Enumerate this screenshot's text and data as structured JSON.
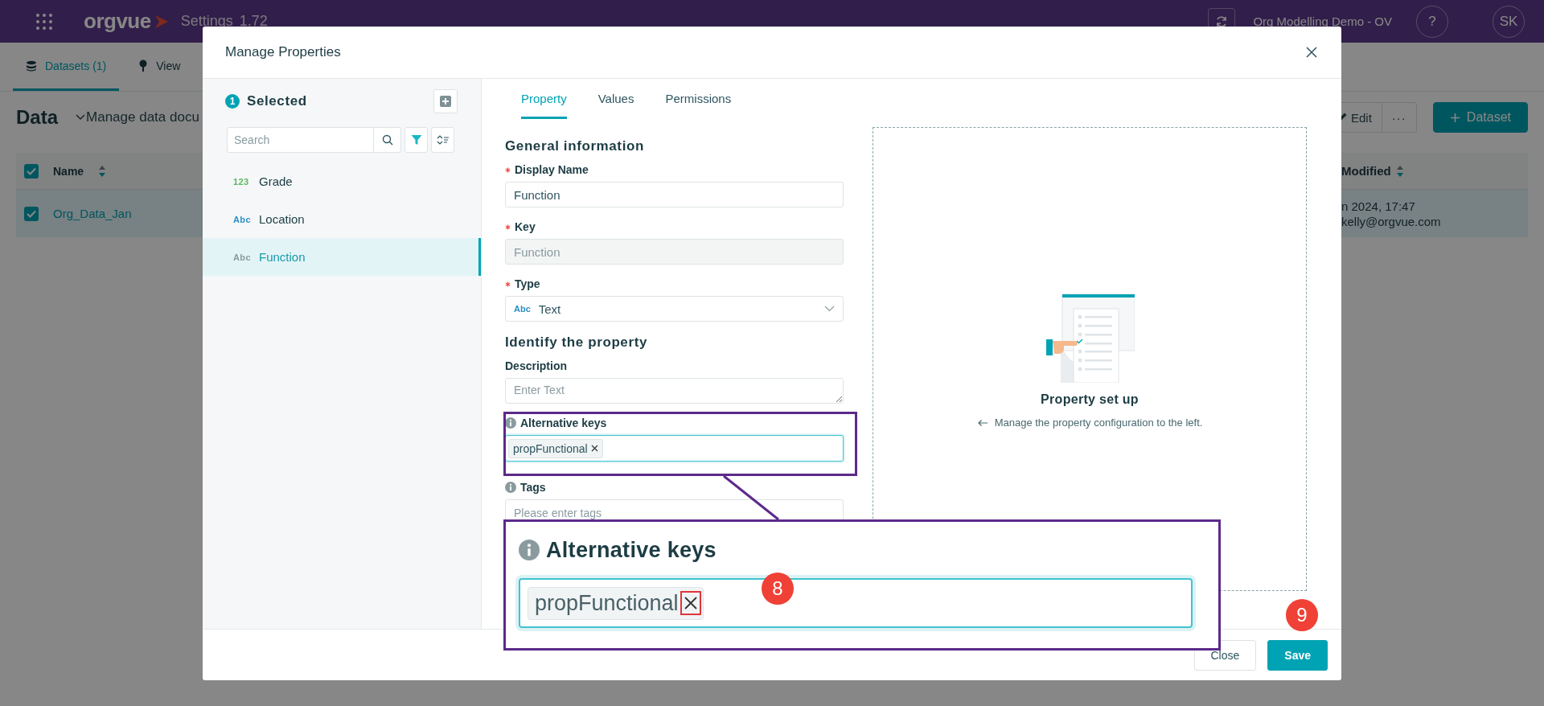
{
  "app_bar": {
    "logo": "orgvue",
    "title": "Settings",
    "version": "1.72",
    "workspace": "Org Modelling Demo - OV",
    "help": "?",
    "avatar": "SK"
  },
  "page_tabs": [
    {
      "label": "Datasets (1)",
      "selected": true
    },
    {
      "label": "View",
      "selected": false
    }
  ],
  "page": {
    "title": "Data",
    "subtitle": "Manage data docu",
    "actions": [
      {
        "kind": "edit",
        "label": "Edit"
      },
      {
        "kind": "more",
        "label": "···"
      },
      {
        "kind": "primary",
        "label": "Dataset"
      }
    ]
  },
  "table": {
    "all_checked": true,
    "columns": [
      {
        "label": "Name"
      },
      {
        "label": "Modified"
      }
    ],
    "rows": [
      {
        "checked": true,
        "name": "Org_Data_Jan",
        "modified": "n 2024, 17:47",
        "modified_by": "kelly@orgvue.com"
      }
    ]
  },
  "dialog": {
    "title": "Manage Properties",
    "selected_count": "1",
    "selected_label": "Selected",
    "search_placeholder": "Search",
    "properties": [
      {
        "type_label": "123",
        "color": "#5cb85c",
        "name": "Grade",
        "selected": false
      },
      {
        "type_label": "Abc",
        "color": "#2a8fc8",
        "name": "Location",
        "selected": false
      },
      {
        "type_label": "Abc",
        "color": "#8a9ba0",
        "name": "Function",
        "selected": true
      }
    ],
    "tabs": [
      {
        "label": "Property",
        "selected": true
      },
      {
        "label": "Values",
        "selected": false
      },
      {
        "label": "Permissions",
        "selected": false
      }
    ],
    "sections": [
      {
        "title": "General information",
        "fields": [
          {
            "label": "Display Name",
            "kind": "text",
            "required": true,
            "info": false,
            "disabled": false,
            "focused": false,
            "value": "Function"
          },
          {
            "label": "Key",
            "kind": "text",
            "required": true,
            "info": false,
            "disabled": true,
            "focused": false,
            "value": "Function"
          },
          {
            "label": "Type",
            "kind": "select",
            "required": true,
            "info": false,
            "disabled": false,
            "focused": false,
            "type_label": "Abc",
            "value": "Text"
          }
        ]
      },
      {
        "title": "Identify the property",
        "fields": [
          {
            "label": "Description",
            "kind": "textarea",
            "required": false,
            "info": false,
            "disabled": false,
            "focused": false,
            "placeholder": "Enter Text"
          },
          {
            "label": "Alternative keys",
            "kind": "tags",
            "required": false,
            "info": true,
            "disabled": false,
            "focused": true,
            "tags": [
              "propFunctional"
            ]
          },
          {
            "label": "Tags",
            "kind": "tags",
            "required": false,
            "info": true,
            "disabled": false,
            "focused": false,
            "placeholder": "Please enter tags"
          }
        ]
      }
    ],
    "preview": {
      "title": "Property set up",
      "hint": "Manage the property configuration to the left."
    },
    "buttons": [
      {
        "kind": "secondary",
        "label": "Close"
      },
      {
        "kind": "primary",
        "label": "Save"
      }
    ]
  },
  "callout": {
    "label": "Alternative keys",
    "tag": "propFunctional",
    "markers": [
      {
        "label": "8"
      },
      {
        "label": "9"
      }
    ]
  }
}
